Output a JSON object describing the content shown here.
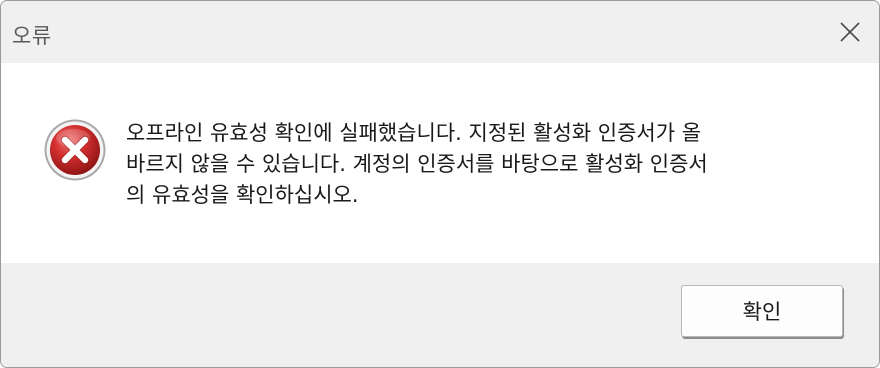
{
  "window": {
    "title": "오류",
    "close_icon": "close-icon"
  },
  "content": {
    "icon": "error-icon",
    "message_lines": [
      "오프라인 유효성 확인에 실패했습니다. 지정된 활성화 인증서가 올",
      "바르지 않을 수 있습니다. 계정의 인증서를 바탕으로 활성화 인증서",
      "의 유효성을 확인하십시오."
    ]
  },
  "footer": {
    "ok_label": "확인"
  },
  "colors": {
    "error_red": "#c62828",
    "dialog_bg": "#f0f0f0",
    "content_bg": "#ffffff"
  }
}
